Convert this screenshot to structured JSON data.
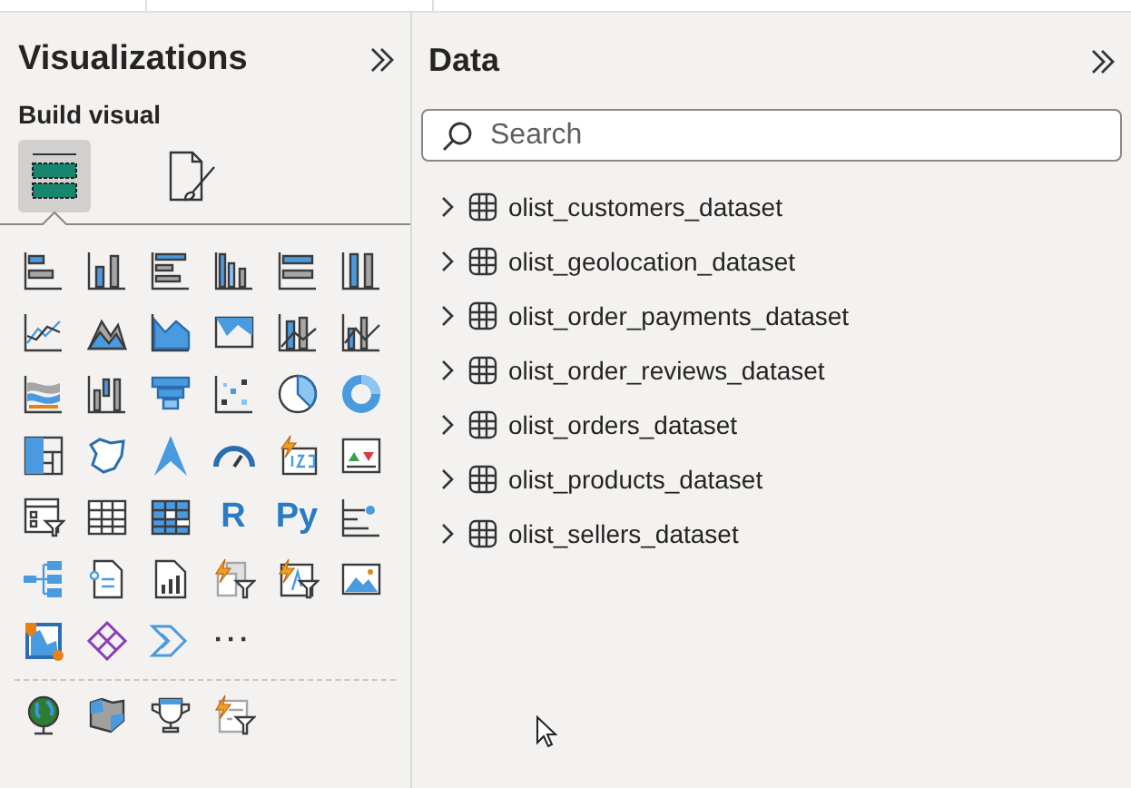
{
  "visualizations": {
    "title": "Visualizations",
    "section_label": "Build visual",
    "build_tabs": [
      {
        "selected": true
      },
      {
        "selected": false
      }
    ],
    "text_tiles": [
      "R",
      "Py",
      "···"
    ]
  },
  "data": {
    "title": "Data",
    "search": {
      "placeholder": "Search"
    },
    "tables": [
      {
        "name": "olist_customers_dataset",
        "expanded": false
      },
      {
        "name": "olist_geolocation_dataset",
        "expanded": false
      },
      {
        "name": "olist_order_payments_dataset",
        "expanded": false
      },
      {
        "name": "olist_order_reviews_dataset",
        "expanded": false
      },
      {
        "name": "olist_orders_dataset",
        "expanded": false
      },
      {
        "name": "olist_products_dataset",
        "expanded": false
      },
      {
        "name": "olist_sellers_dataset",
        "expanded": false
      }
    ]
  }
}
